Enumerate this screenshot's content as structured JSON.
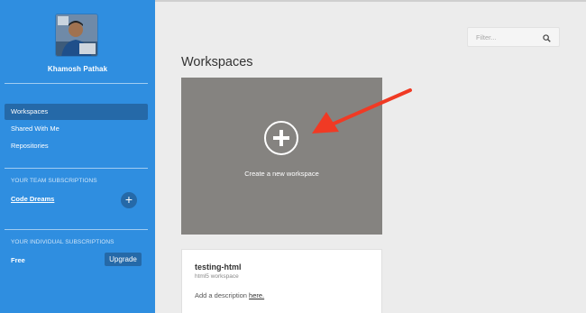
{
  "sidebar": {
    "user_name": "Khamosh Pathak",
    "nav": [
      {
        "label": "Workspaces"
      },
      {
        "label": "Shared With Me"
      },
      {
        "label": "Repositories"
      }
    ],
    "team_section_label": "YOUR TEAM SUBSCRIPTIONS",
    "team_name": "Code Dreams",
    "add_team_icon": "plus-icon",
    "individual_section_label": "YOUR INDIVIDUAL SUBSCRIPTIONS",
    "plan": "Free",
    "upgrade_label": "Upgrade"
  },
  "filter": {
    "placeholder": "Filter...",
    "icon": "search-icon"
  },
  "main": {
    "title": "Workspaces",
    "create_card": {
      "label": "Create a new workspace",
      "icon": "plus-circle-icon"
    },
    "workspace_card": {
      "name": "testing-html",
      "type": "html5 workspace",
      "description_prefix": "Add a description",
      "description_link": "here."
    }
  },
  "annotation": {
    "icon": "red-arrow-icon",
    "color": "#f03a24"
  },
  "colors": {
    "sidebar": "#2f8ee0",
    "sidebar_active": "#2569a8",
    "card": "#858380"
  }
}
